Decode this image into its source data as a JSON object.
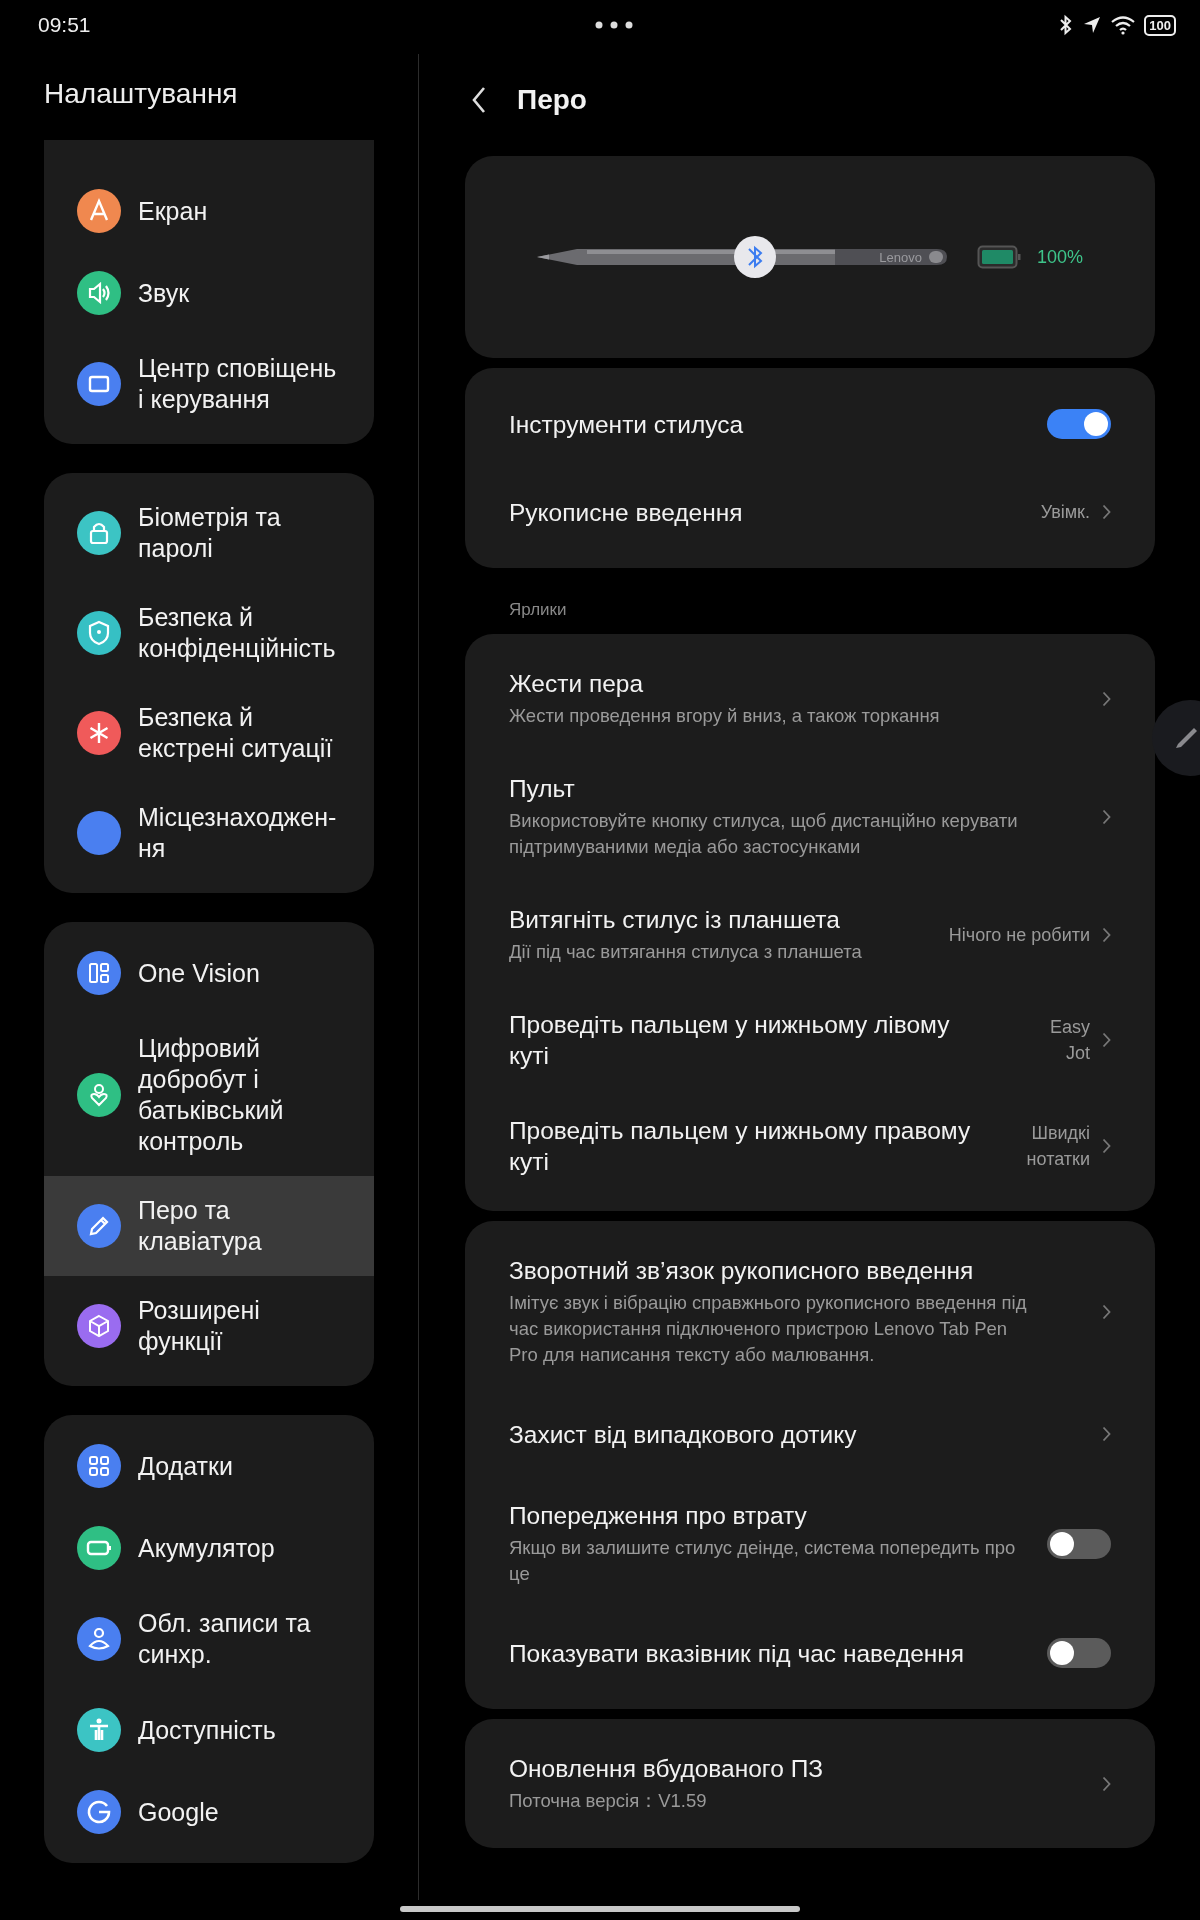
{
  "status_bar": {
    "time": "09:51",
    "battery": "100"
  },
  "sidebar": {
    "title": "Налаштування",
    "groups": [
      {
        "items": [
          {
            "label": "Екран",
            "color": "#f0884f",
            "selected": false
          },
          {
            "label": "Звук",
            "color": "#2fbf84",
            "selected": false
          },
          {
            "label": "Центр сповіщень і керування",
            "color": "#4a7ff0",
            "selected": false
          }
        ]
      },
      {
        "items": [
          {
            "label": "Біометрія та паролі",
            "color": "#3cc4c4",
            "selected": false
          },
          {
            "label": "Безпека й конфіденційність",
            "color": "#36c0c4",
            "selected": false
          },
          {
            "label": "Безпека й екстрені ситуації",
            "color": "#f05a5a",
            "selected": false
          },
          {
            "label": "Місцезнаходжен-ня",
            "color": "#4a7ff0",
            "selected": false
          }
        ]
      },
      {
        "items": [
          {
            "label": "One Vision",
            "color": "#4a7ff0",
            "selected": false
          },
          {
            "label": "Цифровий добробут і батьківський контроль",
            "color": "#2fbf84",
            "selected": false
          },
          {
            "label": "Перо та клавіатура",
            "color": "#4a7ff0",
            "selected": true
          },
          {
            "label": "Розширені функції",
            "color": "#9a6cf0",
            "selected": false
          }
        ]
      },
      {
        "items": [
          {
            "label": "Додатки",
            "color": "#4a7ff0",
            "selected": false
          },
          {
            "label": "Акумулятор",
            "color": "#2fbf84",
            "selected": false
          },
          {
            "label": "Обл. записи та синхр.",
            "color": "#4a7ff0",
            "selected": false
          },
          {
            "label": "Доступність",
            "color": "#3cc4c4",
            "selected": false
          },
          {
            "label": "Google",
            "color": "#4a7ff0",
            "selected": false
          }
        ]
      }
    ]
  },
  "page": {
    "title": "Перо",
    "pen": {
      "brand": "Lenovo",
      "level": 1.0,
      "battery": "100%"
    },
    "sections": [
      {
        "rows": [
          {
            "kind": "toggle",
            "title": "Інструменти стилуса",
            "on": true
          },
          {
            "kind": "link",
            "title": "Рукописне введення",
            "value": "Увімк."
          }
        ]
      },
      {
        "header": "Ярлики",
        "rows": [
          {
            "kind": "link",
            "title": "Жести пера",
            "subtitle": "Жести проведення вгору й вниз, а також торкання"
          },
          {
            "kind": "link",
            "title": "Пульт",
            "subtitle": "Використовуйте кнопку стилуса, щоб дистанційно керувати підтримуваними медіа або застосунками"
          },
          {
            "kind": "link",
            "title": "Витягніть стилус із планшета",
            "subtitle": "Дії під час витягання стилуса з планшета",
            "value": "Нічого не робити"
          },
          {
            "kind": "link",
            "title": "Проведіть пальцем у нижньому лівому куті",
            "value": "Easy Jot"
          },
          {
            "kind": "link",
            "title": "Проведіть пальцем у нижньому правому куті",
            "value": "Швидкі нотатки"
          }
        ]
      },
      {
        "rows": [
          {
            "kind": "link",
            "title": "Зворотний зв’язок рукописного введення",
            "subtitle": "Імітує звук і вібрацію справжнього рукописного введення під час використання підключеного пристрою Lenovo Tab Pen Pro для написання тексту або малювання."
          },
          {
            "kind": "link",
            "title": "Захист від випадкового дотику"
          },
          {
            "kind": "toggle",
            "title": "Попередження про втрату",
            "subtitle": "Якщо ви залишите стилус деінде, система попередить про це",
            "on": false
          },
          {
            "kind": "toggle",
            "title": "Показувати вказівник під час наведення",
            "on": false
          }
        ]
      },
      {
        "rows": [
          {
            "kind": "link",
            "title": "Оновлення вбудованого ПЗ",
            "subtitle": "Поточна версія：V1.59"
          }
        ]
      }
    ]
  }
}
